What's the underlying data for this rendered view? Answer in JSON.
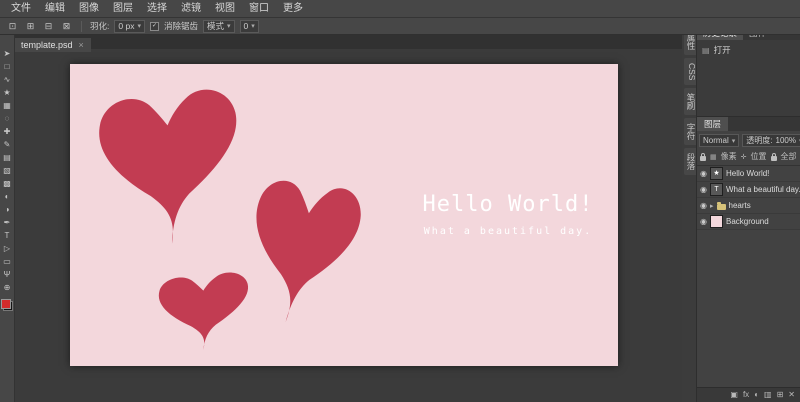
{
  "app": {
    "theme_bg": "#3c3c3c",
    "panel_bg": "#474747",
    "workspace_bg": "#3b3b3b"
  },
  "menubar": {
    "items": [
      "文件",
      "编辑",
      "图像",
      "图层",
      "选择",
      "滤镜",
      "视图",
      "窗口",
      "更多"
    ]
  },
  "options_bar": {
    "selection_icons": [
      "⊡",
      "⊞",
      "⊟",
      "⊠"
    ],
    "feather_label": "羽化:",
    "feather_value": "0 px",
    "antialias_label": "消除锯齿",
    "mode_value": "模式",
    "extra_value": "0",
    "check": "✓"
  },
  "tabbar": {
    "tabs": [
      {
        "title": "template.psd",
        "close": "×"
      }
    ]
  },
  "toolbox": {
    "foreground_color": "#d22b2b",
    "background_color": "#141414",
    "tools": [
      {
        "name": "move-tool",
        "glyph": "➤"
      },
      {
        "name": "marquee-tool",
        "glyph": "□"
      },
      {
        "name": "lasso-tool",
        "glyph": "∿"
      },
      {
        "name": "magic-wand-tool",
        "glyph": "★"
      },
      {
        "name": "crop-tool",
        "glyph": "▦"
      },
      {
        "name": "eyedropper-tool",
        "glyph": "◌"
      },
      {
        "name": "healing-tool",
        "glyph": "✚"
      },
      {
        "name": "brush-tool",
        "glyph": "✎"
      },
      {
        "name": "clone-stamp-tool",
        "glyph": "▤"
      },
      {
        "name": "eraser-tool",
        "glyph": "▧"
      },
      {
        "name": "gradient-tool",
        "glyph": "▩"
      },
      {
        "name": "blur-tool",
        "glyph": "◐"
      },
      {
        "name": "dodge-tool",
        "glyph": "◑"
      },
      {
        "name": "pen-tool",
        "glyph": "✒"
      },
      {
        "name": "text-tool",
        "glyph": "T"
      },
      {
        "name": "path-select-tool",
        "glyph": "▷"
      },
      {
        "name": "shape-tool",
        "glyph": "▭"
      },
      {
        "name": "hand-tool",
        "glyph": "Ψ"
      },
      {
        "name": "zoom-tool",
        "glyph": "⊕"
      }
    ]
  },
  "canvas": {
    "background": "#f3d7dc",
    "heart_color": "#c23c52",
    "title": "Hello World!",
    "subtitle": "What a beautiful day."
  },
  "side_tabs": {
    "items": [
      "属性",
      "CSS",
      "笔刷",
      "字符",
      "段落"
    ]
  },
  "right_panel": {
    "tabs": [
      "历史记录",
      "图样"
    ],
    "history_items": [
      {
        "icon": "▤",
        "label": "打开"
      }
    ],
    "layers_tab": "图层",
    "blend_mode": "Normal",
    "opacity_label": "透明度:",
    "opacity_value": "100%",
    "lock_labels": {
      "pixels": "像素",
      "position": "位置",
      "all": "全部"
    },
    "layers": [
      {
        "name": "Hello World!"
      },
      {
        "name": "What a beautiful day."
      },
      {
        "name": "hearts"
      },
      {
        "name": "Background"
      }
    ],
    "bottom_icons": [
      {
        "name": "add-mask",
        "glyph": "▣"
      },
      {
        "name": "layer-fx",
        "glyph": "fx"
      },
      {
        "name": "adjustments",
        "glyph": "◐"
      },
      {
        "name": "new-folder",
        "glyph": "▥"
      },
      {
        "name": "new-layer",
        "glyph": "⊞"
      },
      {
        "name": "delete-layer",
        "glyph": "✕"
      }
    ]
  },
  "icons": {
    "eye": "◉",
    "expand": "▸",
    "star": "★",
    "text_thumb": "T",
    "dropdown": "▾",
    "pixels_icon": "▦",
    "position_icon": "✛"
  }
}
